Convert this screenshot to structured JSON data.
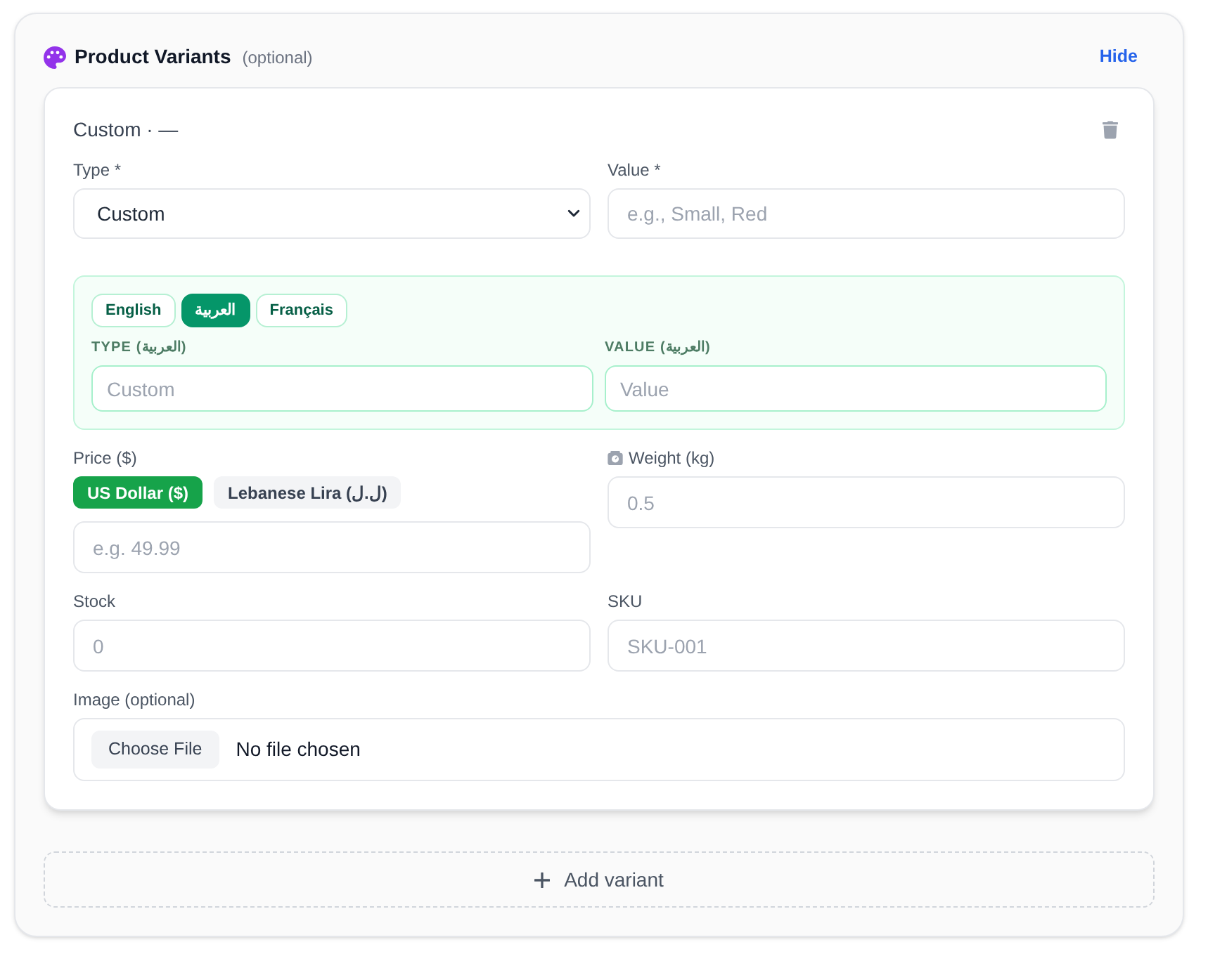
{
  "section": {
    "title": "Product Variants",
    "note": "(optional)",
    "toggle": "Hide"
  },
  "variants": [
    {
      "heading": "Custom · —",
      "type": {
        "label": "Type *",
        "value": "Custom"
      },
      "value": {
        "label": "Value *",
        "placeholder": "e.g., Small, Red"
      },
      "translations": {
        "languages": [
          {
            "label": "English",
            "selected": false
          },
          {
            "label": "العربية",
            "selected": true
          },
          {
            "label": "Français",
            "selected": false
          }
        ],
        "type_field": {
          "label": "TYPE (العربية)",
          "placeholder": "Custom"
        },
        "value_field": {
          "label": "VALUE (العربية)",
          "placeholder": "Value"
        }
      },
      "price": {
        "label": "Price ($)",
        "currencies": [
          {
            "label": "US Dollar ($)",
            "selected": true
          },
          {
            "label": "Lebanese Lira (ل.ل)",
            "selected": false
          }
        ],
        "placeholder": "e.g. 49.99"
      },
      "weight": {
        "label": "Weight (kg)",
        "placeholder": "0.5"
      },
      "stock": {
        "label": "Stock",
        "placeholder": "0"
      },
      "sku": {
        "label": "SKU",
        "placeholder": "SKU-001"
      },
      "image": {
        "label": "Image (optional)",
        "button": "Choose File",
        "status": "No file chosen"
      }
    }
  ],
  "add_button": "Add variant"
}
